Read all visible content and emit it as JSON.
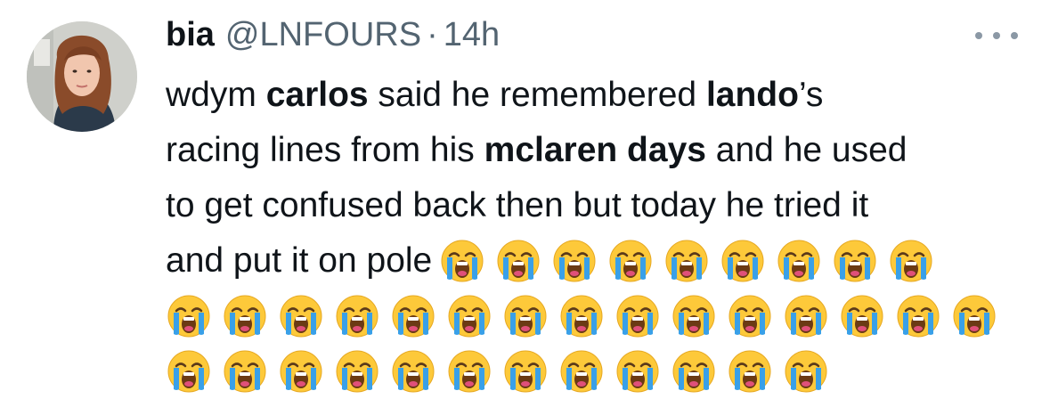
{
  "author": {
    "display_name": "bia",
    "handle": "@LNFOURS",
    "separator": "·",
    "timestamp": "14h",
    "avatar_icon": "profile-photo"
  },
  "more_menu": {
    "icon": "more-horizontal-icon"
  },
  "tweet": {
    "line1": [
      "wdym ",
      "carlos",
      " said he remembered ",
      "lando",
      "’s"
    ],
    "line2": [
      "racing lines from his ",
      "mclaren days",
      " and he used"
    ],
    "line3": "to get confused back then but today he tried it",
    "line4": "and put it on pole",
    "emoji_name": "loudly-crying-face-emoji",
    "emoji_rows": [
      9,
      15,
      12
    ]
  },
  "colors": {
    "text": "#0f1419",
    "secondary": "#536471",
    "emoji_face": "#fdc93a",
    "emoji_tears": "#39a0e8"
  }
}
